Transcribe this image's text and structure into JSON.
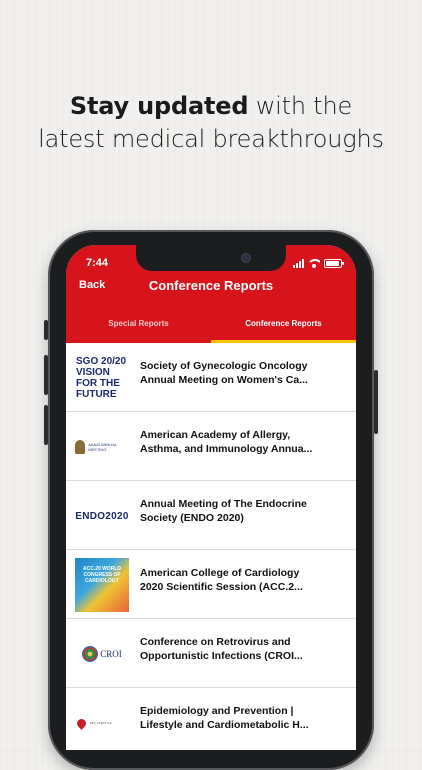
{
  "headline": {
    "bold": "Stay updated",
    "rest": " with the",
    "line2": "latest medical breakthroughs"
  },
  "status_bar": {
    "time": "7:44"
  },
  "app_bar": {
    "back_label": "Back",
    "title": "Conference Reports",
    "accent_color": "#d7131b",
    "tab_indicator_color": "#f7c600"
  },
  "tabs": [
    {
      "label": "Special Reports",
      "active": false
    },
    {
      "label": "Conference Reports",
      "active": true
    }
  ],
  "reports": [
    {
      "logo": "SGO 20/20 VISION FOR THE FUTURE",
      "line1": "Society of Gynecologic Oncology",
      "line2": "Annual Meeting on Women's Ca..."
    },
    {
      "logo": "AAAAI ANNUAL MEETING",
      "line1": "American Academy of Allergy,",
      "line2": "Asthma, and Immunology Annua..."
    },
    {
      "logo": "ENDO2020",
      "line1": "Annual Meeting of The Endocrine",
      "line2": "Society (ENDO 2020)"
    },
    {
      "logo": "ACC.20 WORLD CONGRESS OF CARDIOLOGY",
      "line1": "American College of Cardiology",
      "line2": "2020 Scientific Session (ACC.2..."
    },
    {
      "logo": "CROI",
      "line1": "Conference on Retrovirus and",
      "line2": "Opportunistic Infections (CROI..."
    },
    {
      "logo": "EPI | LIFESTYLE",
      "line1": "Epidemiology and Prevention |",
      "line2": "Lifestyle and Cardiometabolic H..."
    }
  ]
}
